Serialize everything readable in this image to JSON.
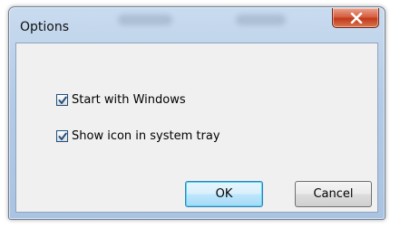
{
  "window": {
    "title": "Options",
    "close_symbol": "x"
  },
  "options": [
    {
      "label": "Start with Windows",
      "checked": true
    },
    {
      "label": "Show icon in system tray",
      "checked": true
    }
  ],
  "buttons": {
    "ok_label": "OK",
    "cancel_label": "Cancel"
  },
  "icons": {
    "close": "close-icon",
    "check": "checkmark-icon"
  },
  "colors": {
    "title_bar": "#b3cbe6",
    "close_button": "#c1391c",
    "dialog_background": "#f0f0f0",
    "default_button_border": "#3c7fb1",
    "checkbox_border": "#1c5180"
  }
}
